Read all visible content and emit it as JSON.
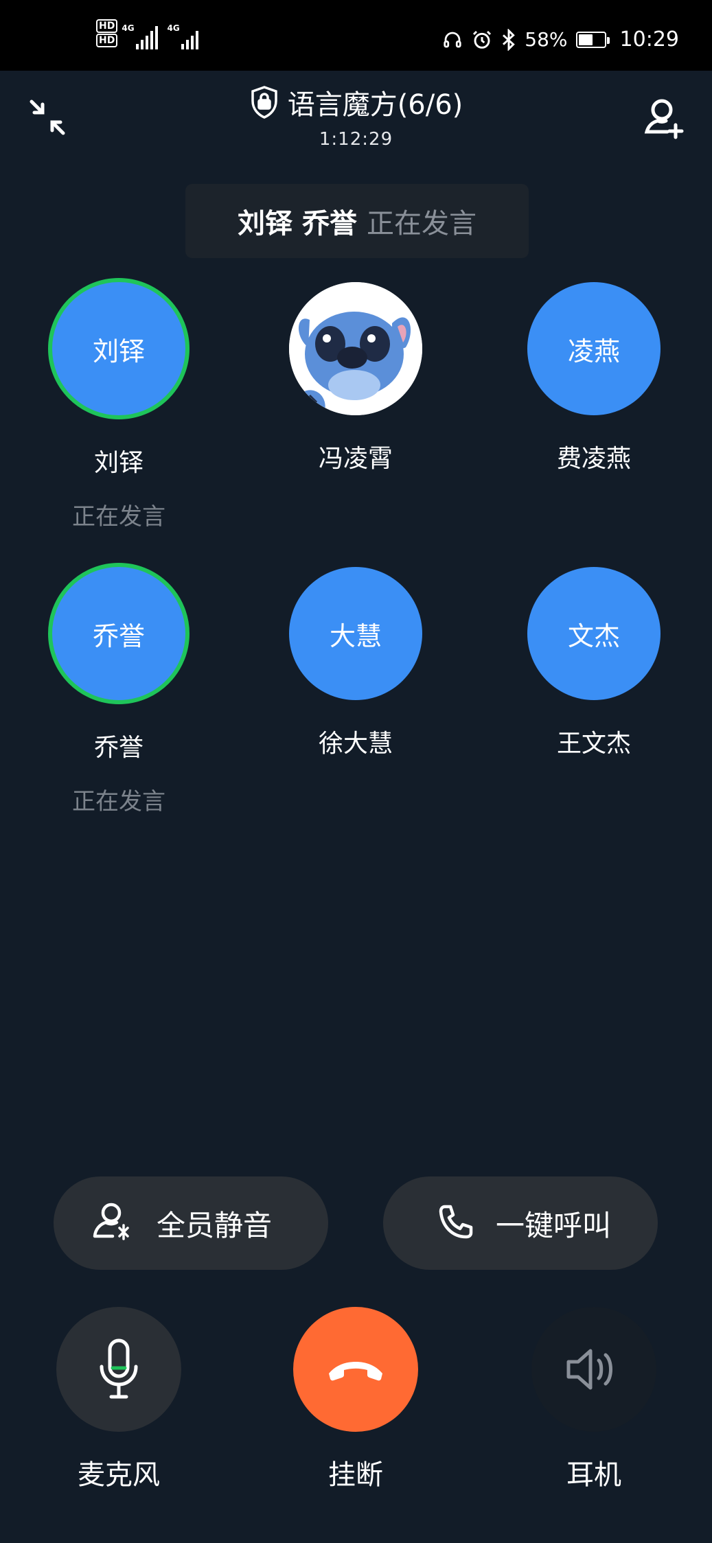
{
  "status_bar": {
    "sim1_label": "HD",
    "sim2_label": "HD",
    "sim1_network": "4G",
    "sim2_network": "4G",
    "battery_percent": "58%",
    "battery_level": 0.58,
    "time": "10:29"
  },
  "header": {
    "title": "语言魔方(6/6)",
    "duration": "1:12:29"
  },
  "speaking_banner": {
    "names": "刘铎 乔誉",
    "state": "正在发言"
  },
  "members": [
    {
      "avatar_text": "刘铎",
      "name": "刘铎",
      "status": "正在发言",
      "speaking": true
    },
    {
      "avatar_text": "",
      "name": "冯凌霄",
      "status": "",
      "speaking": false,
      "avatar_image": "cartoon-character-avatar"
    },
    {
      "avatar_text": "凌燕",
      "name": "费凌燕",
      "status": "",
      "speaking": false
    },
    {
      "avatar_text": "乔誉",
      "name": "乔誉",
      "status": "正在发言",
      "speaking": true
    },
    {
      "avatar_text": "大慧",
      "name": "徐大慧",
      "status": "",
      "speaking": false
    },
    {
      "avatar_text": "文杰",
      "name": "王文杰",
      "status": "",
      "speaking": false
    }
  ],
  "actions": {
    "mute_all": "全员静音",
    "call_all": "一键呼叫"
  },
  "controls": {
    "microphone": "麦克风",
    "hangup": "挂断",
    "earpiece": "耳机"
  },
  "colors": {
    "background": "#121c28",
    "avatar_blue": "#3b8ff5",
    "speaking_ring": "#1fc45a",
    "hangup_orange": "#ff6a33",
    "pill_bg": "#2a2f35"
  }
}
